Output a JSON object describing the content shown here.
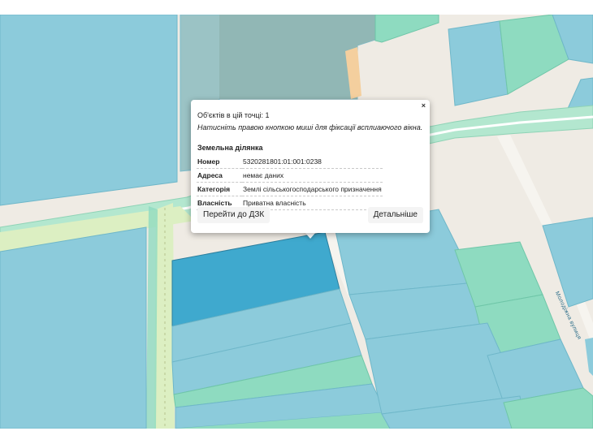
{
  "map": {
    "street_label": "Молодіжна вулиця",
    "colors": {
      "background": "#efebe4",
      "parcel_blue": "#8ccbdb",
      "parcel_green": "#8edbc0",
      "selected_parcel": "#3fa9ce",
      "road_green": "#b3e7cf",
      "road_strip": "#dcefc2",
      "orange_strip": "#f4cf9e"
    }
  },
  "popup": {
    "close_label": "×",
    "count_text": "Об'єктів в цій точці: 1",
    "hint_text": "Натисніть правою кнопкою миші для фіксації всплиаючого вікна.",
    "section_title": "Земельна ділянка",
    "rows": [
      {
        "key": "Номер",
        "value": "5320281801:01:001:0238"
      },
      {
        "key": "Адреса",
        "value": "немає даних"
      },
      {
        "key": "Категорія",
        "value": "Землі сільськогосподарського призначення"
      },
      {
        "key": "Власність",
        "value": "Приватна власність"
      }
    ],
    "button_dzk": "Перейти до ДЗК",
    "button_details": "Детальніше"
  }
}
